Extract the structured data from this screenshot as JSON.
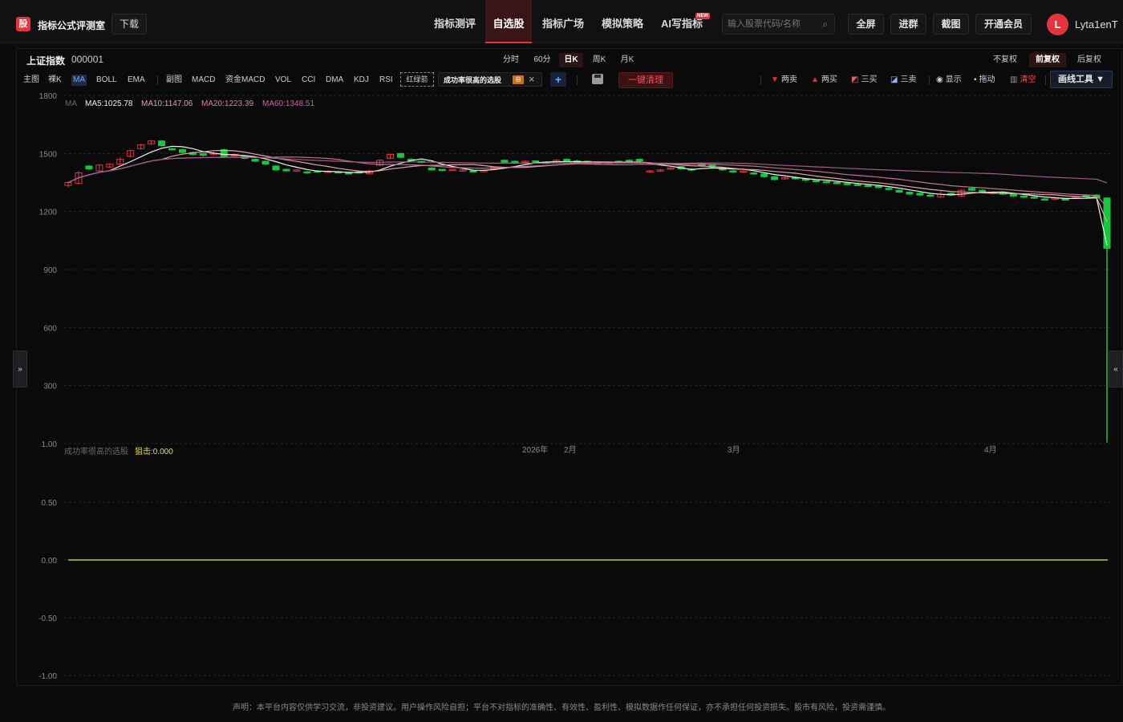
{
  "header": {
    "logo_char": "股",
    "app_title": "指标公式评测室",
    "download": "下载",
    "nav": [
      "指标测评",
      "自选股",
      "指标广场",
      "模拟策略",
      "AI写指标"
    ],
    "nav_active": "自选股",
    "new_badge": "NEW",
    "search_placeholder": "输入股票代码/名称",
    "buttons": [
      "全屏",
      "进群",
      "截图",
      "开通会员"
    ],
    "avatar_letter": "L",
    "username": "Lyta1enT"
  },
  "toolbar": {
    "stock_name": "上证指数",
    "stock_code": "000001",
    "periods": [
      "分时",
      "60分",
      "日K",
      "周K",
      "月K"
    ],
    "period_active": "日K",
    "adjust": [
      "不复权",
      "前复权",
      "后复权"
    ],
    "adjust_active": "前复权",
    "indicators": [
      "主图",
      "裸K",
      "MA",
      "BOLL",
      "EMA",
      "副图",
      "MACD",
      "资金MACD",
      "VOL",
      "CCI",
      "DMA",
      "KDJ",
      "RSI"
    ],
    "indicator_active": "MA",
    "red_green": "红绿箭",
    "strategy": "成功率很高的选股",
    "strategy_badge": "自",
    "plus": "+",
    "clear": "一键清理",
    "signals": [
      "两卖",
      "两买",
      "三买",
      "三卖",
      "显示",
      "拖动",
      "清空"
    ],
    "draw_tools": "画线工具 ▼"
  },
  "main_chart": {
    "ma_legend": {
      "label": "MA",
      "ma5": "MA5:1025.78",
      "ma10": "MA10:1147.06",
      "ma20": "MA20:1223.39",
      "ma60": "MA60:1348.51"
    },
    "y_ticks": [
      "1800",
      "1500",
      "1200",
      "900",
      "600",
      "300",
      "1.00"
    ],
    "x_labels": [
      "2026年",
      "2月",
      "3月",
      "4月"
    ]
  },
  "sub_chart": {
    "title": "成功率很高的选股",
    "value": "狙击:0.000",
    "y_ticks": [
      "0.50",
      "0.00",
      "-0.50",
      "-1.00"
    ]
  },
  "colors": {
    "up": "#e6343c",
    "down": "#14c83c",
    "ma5": "#f0f0f0",
    "ma10": "#e8a0a8",
    "ma20": "#c07090",
    "ma60": "#a05a8a",
    "sub_line": "#c8c832"
  },
  "footer": "声明：本平台内容仅供学习交流，非投资建议。用户操作风险自担；平台不对指标的准确性、有效性、盈利性、模拟数据作任何保证，亦不承担任何投资损失。股市有风险，投资需谨慎。",
  "chart_data": {
    "type": "candlestick",
    "ylim": [
      0,
      1800
    ],
    "candles": [
      [
        1335,
        1350,
        1325,
        1355
      ],
      [
        1345,
        1400,
        1340,
        1410
      ],
      [
        1435,
        1420,
        1415,
        1440
      ],
      [
        1410,
        1440,
        1405,
        1445
      ],
      [
        1430,
        1445,
        1425,
        1450
      ],
      [
        1445,
        1470,
        1440,
        1480
      ],
      [
        1485,
        1515,
        1480,
        1520
      ],
      [
        1525,
        1545,
        1520,
        1550
      ],
      [
        1550,
        1565,
        1545,
        1570
      ],
      [
        1565,
        1540,
        1535,
        1570
      ],
      [
        1525,
        1520,
        1515,
        1530
      ],
      [
        1520,
        1505,
        1500,
        1525
      ],
      [
        1505,
        1495,
        1490,
        1510
      ],
      [
        1500,
        1490,
        1485,
        1505
      ],
      [
        1495,
        1500,
        1490,
        1510
      ],
      [
        1520,
        1485,
        1480,
        1525
      ],
      [
        1490,
        1495,
        1485,
        1500
      ],
      [
        1485,
        1475,
        1470,
        1490
      ],
      [
        1470,
        1460,
        1455,
        1475
      ],
      [
        1460,
        1445,
        1440,
        1465
      ],
      [
        1435,
        1415,
        1410,
        1440
      ],
      [
        1418,
        1410,
        1405,
        1422
      ],
      [
        1410,
        1415,
        1405,
        1420
      ],
      [
        1405,
        1400,
        1395,
        1410
      ],
      [
        1410,
        1405,
        1400,
        1415
      ],
      [
        1405,
        1408,
        1400,
        1412
      ],
      [
        1405,
        1400,
        1398,
        1410
      ],
      [
        1400,
        1398,
        1395,
        1405
      ],
      [
        1405,
        1400,
        1398,
        1410
      ],
      [
        1395,
        1410,
        1390,
        1415
      ],
      [
        1440,
        1465,
        1435,
        1470
      ],
      [
        1475,
        1495,
        1470,
        1500
      ],
      [
        1500,
        1480,
        1475,
        1505
      ],
      [
        1470,
        1465,
        1460,
        1475
      ],
      [
        1460,
        1455,
        1450,
        1465
      ],
      [
        1425,
        1415,
        1410,
        1430
      ],
      [
        1418,
        1412,
        1408,
        1420
      ],
      [
        1415,
        1418,
        1410,
        1420
      ],
      [
        1412,
        1415,
        1408,
        1418
      ],
      [
        1410,
        1408,
        1405,
        1415
      ],
      [
        1410,
        1412,
        1405,
        1418
      ],
      [
        1420,
        1430,
        1415,
        1435
      ],
      [
        1465,
        1455,
        1450,
        1470
      ],
      [
        1460,
        1458,
        1455,
        1465
      ],
      [
        1458,
        1460,
        1455,
        1465
      ],
      [
        1462,
        1455,
        1450,
        1465
      ],
      [
        1455,
        1450,
        1445,
        1460
      ],
      [
        1460,
        1465,
        1455,
        1470
      ],
      [
        1470,
        1460,
        1455,
        1475
      ],
      [
        1462,
        1458,
        1455,
        1468
      ],
      [
        1460,
        1450,
        1445,
        1465
      ],
      [
        1455,
        1450,
        1448,
        1460
      ],
      [
        1450,
        1455,
        1445,
        1460
      ],
      [
        1460,
        1455,
        1450,
        1465
      ],
      [
        1465,
        1460,
        1455,
        1470
      ],
      [
        1470,
        1462,
        1455,
        1475
      ],
      [
        1405,
        1410,
        1400,
        1415
      ],
      [
        1410,
        1415,
        1405,
        1420
      ],
      [
        1420,
        1425,
        1415,
        1430
      ],
      [
        1432,
        1420,
        1415,
        1435
      ],
      [
        1420,
        1415,
        1410,
        1425
      ],
      [
        1450,
        1435,
        1430,
        1455
      ],
      [
        1440,
        1430,
        1425,
        1445
      ],
      [
        1425,
        1415,
        1410,
        1430
      ],
      [
        1410,
        1405,
        1400,
        1415
      ],
      [
        1405,
        1410,
        1400,
        1412
      ],
      [
        1400,
        1395,
        1390,
        1405
      ],
      [
        1395,
        1380,
        1375,
        1400
      ],
      [
        1380,
        1365,
        1360,
        1385
      ],
      [
        1370,
        1375,
        1365,
        1380
      ],
      [
        1375,
        1370,
        1365,
        1380
      ],
      [
        1368,
        1362,
        1355,
        1370
      ],
      [
        1360,
        1355,
        1350,
        1365
      ],
      [
        1355,
        1350,
        1345,
        1360
      ],
      [
        1350,
        1345,
        1340,
        1355
      ],
      [
        1345,
        1340,
        1335,
        1350
      ],
      [
        1340,
        1335,
        1330,
        1345
      ],
      [
        1335,
        1330,
        1325,
        1340
      ],
      [
        1330,
        1325,
        1320,
        1335
      ],
      [
        1320,
        1315,
        1310,
        1325
      ],
      [
        1310,
        1300,
        1295,
        1315
      ],
      [
        1300,
        1290,
        1285,
        1305
      ],
      [
        1295,
        1285,
        1280,
        1300
      ],
      [
        1285,
        1280,
        1275,
        1290
      ],
      [
        1275,
        1290,
        1270,
        1305
      ],
      [
        1295,
        1285,
        1280,
        1300
      ],
      [
        1280,
        1310,
        1275,
        1315
      ],
      [
        1320,
        1310,
        1305,
        1325
      ],
      [
        1310,
        1300,
        1295,
        1315
      ],
      [
        1300,
        1295,
        1290,
        1305
      ],
      [
        1300,
        1290,
        1285,
        1305
      ],
      [
        1290,
        1280,
        1275,
        1295
      ],
      [
        1280,
        1275,
        1270,
        1285
      ],
      [
        1275,
        1270,
        1265,
        1280
      ],
      [
        1265,
        1260,
        1255,
        1270
      ],
      [
        1265,
        1270,
        1260,
        1275
      ],
      [
        1265,
        1262,
        1258,
        1270
      ],
      [
        1270,
        1275,
        1265,
        1280
      ],
      [
        1285,
        1275,
        1270,
        1290
      ],
      [
        1285,
        1270,
        1265,
        1290
      ],
      [
        1270,
        1010,
        1000,
        1275
      ]
    ],
    "ma5_final": 1025.78,
    "ma10_final": 1147.06,
    "ma20_final": 1223.39,
    "ma60_final": 1348.51
  }
}
